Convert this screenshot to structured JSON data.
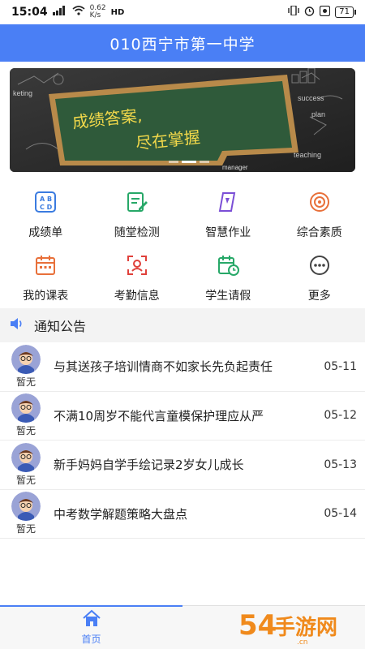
{
  "status_bar": {
    "time": "15:04",
    "network_speed": "0.62",
    "network_unit": "K/s",
    "network_tech": "HD",
    "battery": "71"
  },
  "header": {
    "title": "010西宁市第一中学"
  },
  "banner": {
    "board_line1": "成绩答案,",
    "board_line2": "尽在掌握",
    "doodle_marketing": "keting",
    "doodle_teaching": "teaching",
    "doodle_manager": "manager",
    "doodle_success": "success",
    "doodle_plan": "plan",
    "active_slide": 1,
    "slide_count": 3
  },
  "grid": {
    "row1": [
      {
        "label": "成绩单",
        "icon": "abcd-icon",
        "color": "#3a7be0"
      },
      {
        "label": "随堂检测",
        "icon": "edit-note-icon",
        "color": "#27a868"
      },
      {
        "label": "智慧作业",
        "icon": "homework-icon",
        "color": "#7b4fd6"
      },
      {
        "label": "综合素质",
        "icon": "quality-icon",
        "color": "#e8703a"
      }
    ],
    "row2": [
      {
        "label": "我的课表",
        "icon": "calendar-icon",
        "color": "#e8703a"
      },
      {
        "label": "考勤信息",
        "icon": "attendance-icon",
        "color": "#e0403a"
      },
      {
        "label": "学生请假",
        "icon": "leave-icon",
        "color": "#27a868"
      },
      {
        "label": "更多",
        "icon": "more-icon",
        "color": "#444444"
      }
    ]
  },
  "notice": {
    "title": "通知公告"
  },
  "news": [
    {
      "author": "暂无",
      "title": "与其送孩子培训情商不如家长先负起责任",
      "date": "05-11"
    },
    {
      "author": "暂无",
      "title": "不满10周岁不能代言童模保护理应从严",
      "date": "05-12"
    },
    {
      "author": "暂无",
      "title": "新手妈妈自学手绘记录2岁女儿成长",
      "date": "05-13"
    },
    {
      "author": "暂无",
      "title": "中考数学解题策略大盘点",
      "date": "05-14"
    }
  ],
  "tabbar": {
    "home_label": "首页"
  },
  "watermark": {
    "text": "54手游网",
    "sub": "www.54ys.cn"
  }
}
